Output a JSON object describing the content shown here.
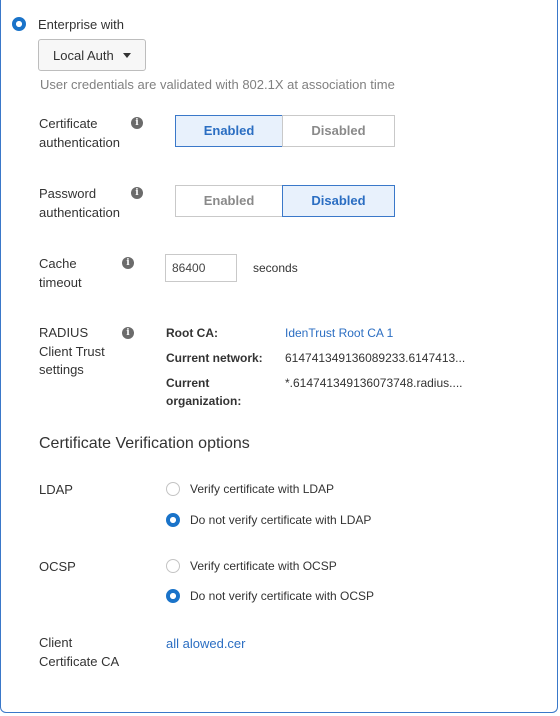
{
  "enterprise": {
    "label": "Enterprise with",
    "auth_select": "Local Auth",
    "description": "User credentials are validated with 802.1X at association time"
  },
  "cert_auth": {
    "label_line1": "Certificate",
    "label_line2": "authentication",
    "enabled": "Enabled",
    "disabled": "Disabled",
    "selected": "Enabled"
  },
  "password_auth": {
    "label_line1": "Password",
    "label_line2": "authentication",
    "enabled": "Enabled",
    "disabled": "Disabled",
    "selected": "Disabled"
  },
  "cache": {
    "label_line1": "Cache",
    "label_line2": "timeout",
    "value": "86400",
    "unit": "seconds"
  },
  "radius": {
    "label_line1": "RADIUS",
    "label_line2": "Client Trust",
    "label_line3": "settings",
    "root_ca_key": "Root CA:",
    "root_ca_value": "IdenTrust Root CA 1",
    "network_key": "Current network:",
    "network_value": "614741349136089233.6147413...",
    "org_key_line1": "Current",
    "org_key_line2": "organization:",
    "org_value": "*.614741349136073748.radius...."
  },
  "verification": {
    "title": "Certificate Verification options",
    "ldap": {
      "label": "LDAP",
      "option1": "Verify certificate with LDAP",
      "option2": "Do not verify certificate with LDAP",
      "selected": "option2"
    },
    "ocsp": {
      "label": "OCSP",
      "option1": "Verify certificate with OCSP",
      "option2": "Do not verify certificate with OCSP",
      "selected": "option2"
    }
  },
  "client_ca": {
    "label_line1": "Client",
    "label_line2": "Certificate CA",
    "file": "all alowed.cer"
  },
  "colors": {
    "accent": "#1a73c9",
    "link": "#2b6ec2",
    "active_bg": "#e8f1fc",
    "border": "#3a78c9"
  }
}
